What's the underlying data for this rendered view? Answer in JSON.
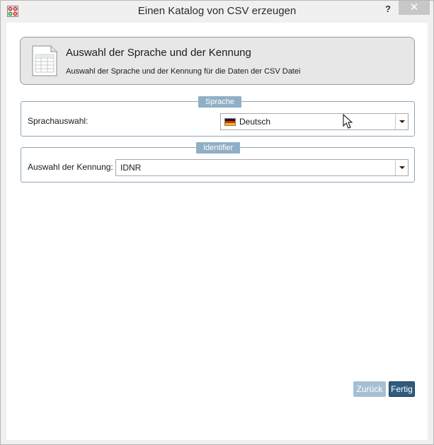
{
  "window": {
    "title": "Einen Katalog von CSV erzeugen",
    "help_label": "?",
    "close_label": "✕"
  },
  "header": {
    "title": "Auswahl der Sprache und der Kennung",
    "subtitle": "Auswahl der Sprache und der Kennung für die Daten der CSV Datei",
    "icon": "spreadsheet-document-icon"
  },
  "sprache_group": {
    "legend": "Sprache",
    "label": "Sprachauswahl:",
    "selected_value": "Deutsch",
    "flag_icon": "german-flag-icon"
  },
  "identifier_group": {
    "legend": "Identifier",
    "label": "Auswahl der Kennung:",
    "selected_value": "IDNR"
  },
  "buttons": {
    "back_label": "Zurück",
    "finish_label": "Fertig"
  },
  "colors": {
    "legend_bg": "#8fafc6",
    "finish_button": "#2e5b7e",
    "back_button_disabled": "#a7bfd2",
    "group_border": "#8ea6bb"
  }
}
